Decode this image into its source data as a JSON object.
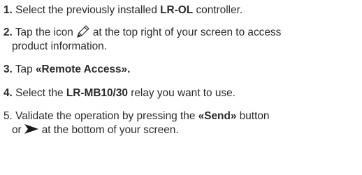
{
  "steps": [
    {
      "number": "1.",
      "before": "Select the previously installed ",
      "bold": "LR-OL",
      "after": " controller."
    },
    {
      "number": "2.",
      "before": "Tap the icon",
      "after_line1": "at the top right of your screen to access",
      "line2": "product information.",
      "icon": "edit-pen-icon"
    },
    {
      "number": "3.",
      "before": "Tap ",
      "bold": "«Remote Access»."
    },
    {
      "number": "4.",
      "before": "Select the ",
      "bold": "LR-MB10/30",
      "after": " relay you want to use."
    },
    {
      "number": "5.",
      "before": "Validate the operation by pressing the ",
      "bold": "«Send»",
      "after": " button",
      "line2_before": "or",
      "line2_after": "at the bottom of your screen.",
      "icon": "send-arrow-icon"
    }
  ]
}
